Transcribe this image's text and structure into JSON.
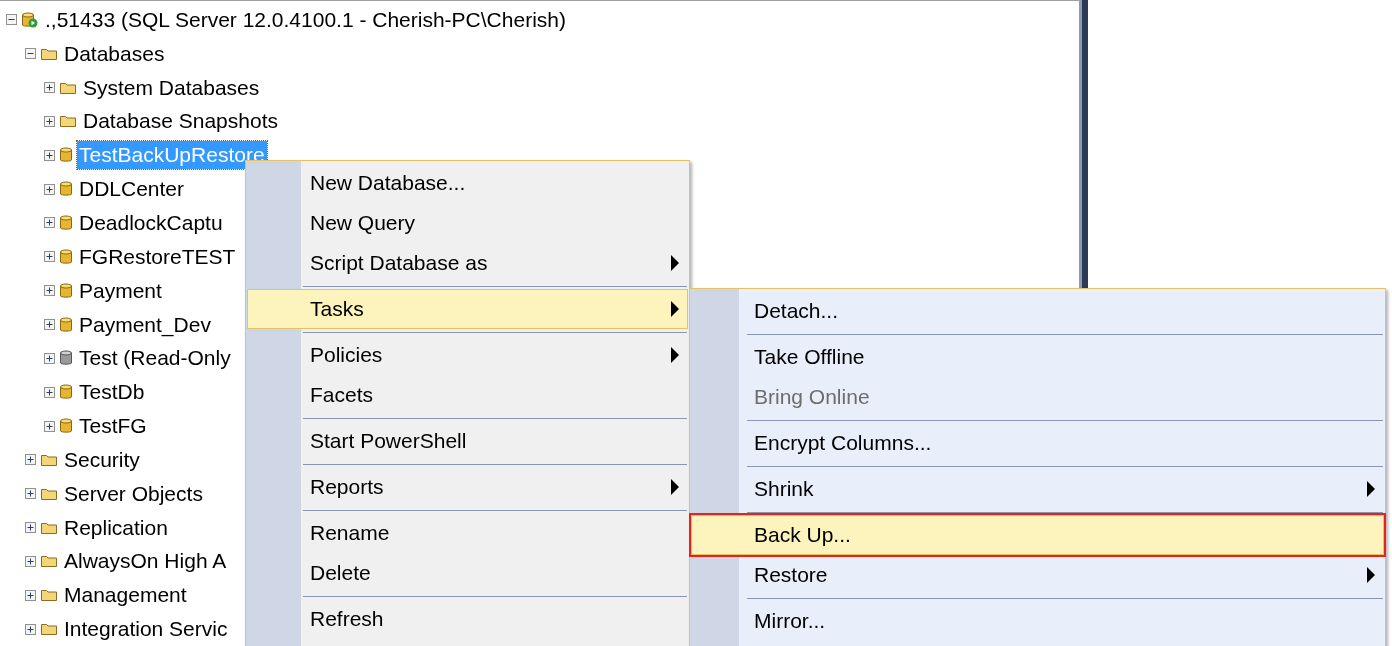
{
  "tree": [
    {
      "label": ".,51433 (SQL Server 12.0.4100.1 - Cherish-PC\\Cherish)",
      "kind": "server",
      "expanded": true,
      "selected": false,
      "children": [
        {
          "label": "Databases",
          "kind": "folder",
          "expanded": true,
          "selected": false,
          "children": [
            {
              "label": "System Databases",
              "kind": "folder",
              "expanded": false,
              "selected": false
            },
            {
              "label": "Database Snapshots",
              "kind": "folder",
              "expanded": false,
              "selected": false
            },
            {
              "label": "TestBackUpRestore",
              "kind": "database",
              "expanded": false,
              "selected": true
            },
            {
              "label": "DDLCenter",
              "kind": "database",
              "expanded": false,
              "selected": false
            },
            {
              "label": "DeadlockCaptu",
              "kind": "database",
              "expanded": false,
              "selected": false
            },
            {
              "label": "FGRestoreTEST",
              "kind": "database",
              "expanded": false,
              "selected": false
            },
            {
              "label": "Payment",
              "kind": "database",
              "expanded": false,
              "selected": false
            },
            {
              "label": "Payment_Dev",
              "kind": "database",
              "expanded": false,
              "selected": false
            },
            {
              "label": "Test (Read-Only",
              "kind": "database_readonly",
              "expanded": false,
              "selected": false
            },
            {
              "label": "TestDb",
              "kind": "database",
              "expanded": false,
              "selected": false
            },
            {
              "label": "TestFG",
              "kind": "database",
              "expanded": false,
              "selected": false
            }
          ]
        },
        {
          "label": "Security",
          "kind": "folder",
          "expanded": false,
          "selected": false
        },
        {
          "label": "Server Objects",
          "kind": "folder",
          "expanded": false,
          "selected": false
        },
        {
          "label": "Replication",
          "kind": "folder",
          "expanded": false,
          "selected": false
        },
        {
          "label": "AlwaysOn High A",
          "kind": "folder",
          "expanded": false,
          "selected": false
        },
        {
          "label": "Management",
          "kind": "folder",
          "expanded": false,
          "selected": false
        },
        {
          "label": "Integration Servic",
          "kind": "folder",
          "expanded": false,
          "selected": false
        }
      ]
    }
  ],
  "context_menu": [
    {
      "kind": "item",
      "label": "New Database...",
      "submenu": false,
      "selected": false,
      "disabled": false
    },
    {
      "kind": "item",
      "label": "New Query",
      "submenu": false,
      "selected": false,
      "disabled": false
    },
    {
      "kind": "item",
      "label": "Script Database as",
      "submenu": true,
      "selected": false,
      "disabled": false
    },
    {
      "kind": "separator"
    },
    {
      "kind": "item",
      "label": "Tasks",
      "submenu": true,
      "selected": true,
      "disabled": false
    },
    {
      "kind": "separator"
    },
    {
      "kind": "item",
      "label": "Policies",
      "submenu": true,
      "selected": false,
      "disabled": false
    },
    {
      "kind": "item",
      "label": "Facets",
      "submenu": false,
      "selected": false,
      "disabled": false
    },
    {
      "kind": "separator"
    },
    {
      "kind": "item",
      "label": "Start PowerShell",
      "submenu": false,
      "selected": false,
      "disabled": false
    },
    {
      "kind": "separator"
    },
    {
      "kind": "item",
      "label": "Reports",
      "submenu": true,
      "selected": false,
      "disabled": false
    },
    {
      "kind": "separator"
    },
    {
      "kind": "item",
      "label": "Rename",
      "submenu": false,
      "selected": false,
      "disabled": false
    },
    {
      "kind": "item",
      "label": "Delete",
      "submenu": false,
      "selected": false,
      "disabled": false
    },
    {
      "kind": "separator"
    },
    {
      "kind": "item",
      "label": "Refresh",
      "submenu": false,
      "selected": false,
      "disabled": false
    }
  ],
  "tasks_submenu": [
    {
      "kind": "item",
      "label": "Detach...",
      "submenu": false,
      "selected": false,
      "disabled": false
    },
    {
      "kind": "separator"
    },
    {
      "kind": "item",
      "label": "Take Offline",
      "submenu": false,
      "selected": false,
      "disabled": false
    },
    {
      "kind": "item",
      "label": "Bring Online",
      "submenu": false,
      "selected": false,
      "disabled": true
    },
    {
      "kind": "separator"
    },
    {
      "kind": "item",
      "label": "Encrypt Columns...",
      "submenu": false,
      "selected": false,
      "disabled": false
    },
    {
      "kind": "separator"
    },
    {
      "kind": "item",
      "label": "Shrink",
      "submenu": true,
      "selected": false,
      "disabled": false
    },
    {
      "kind": "separator"
    },
    {
      "kind": "item",
      "label": "Back Up...",
      "submenu": false,
      "selected": true,
      "disabled": false,
      "outlined": true
    },
    {
      "kind": "item",
      "label": "Restore",
      "submenu": true,
      "selected": false,
      "disabled": false
    },
    {
      "kind": "separator"
    },
    {
      "kind": "item",
      "label": "Mirror...",
      "submenu": false,
      "selected": false,
      "disabled": false
    }
  ]
}
